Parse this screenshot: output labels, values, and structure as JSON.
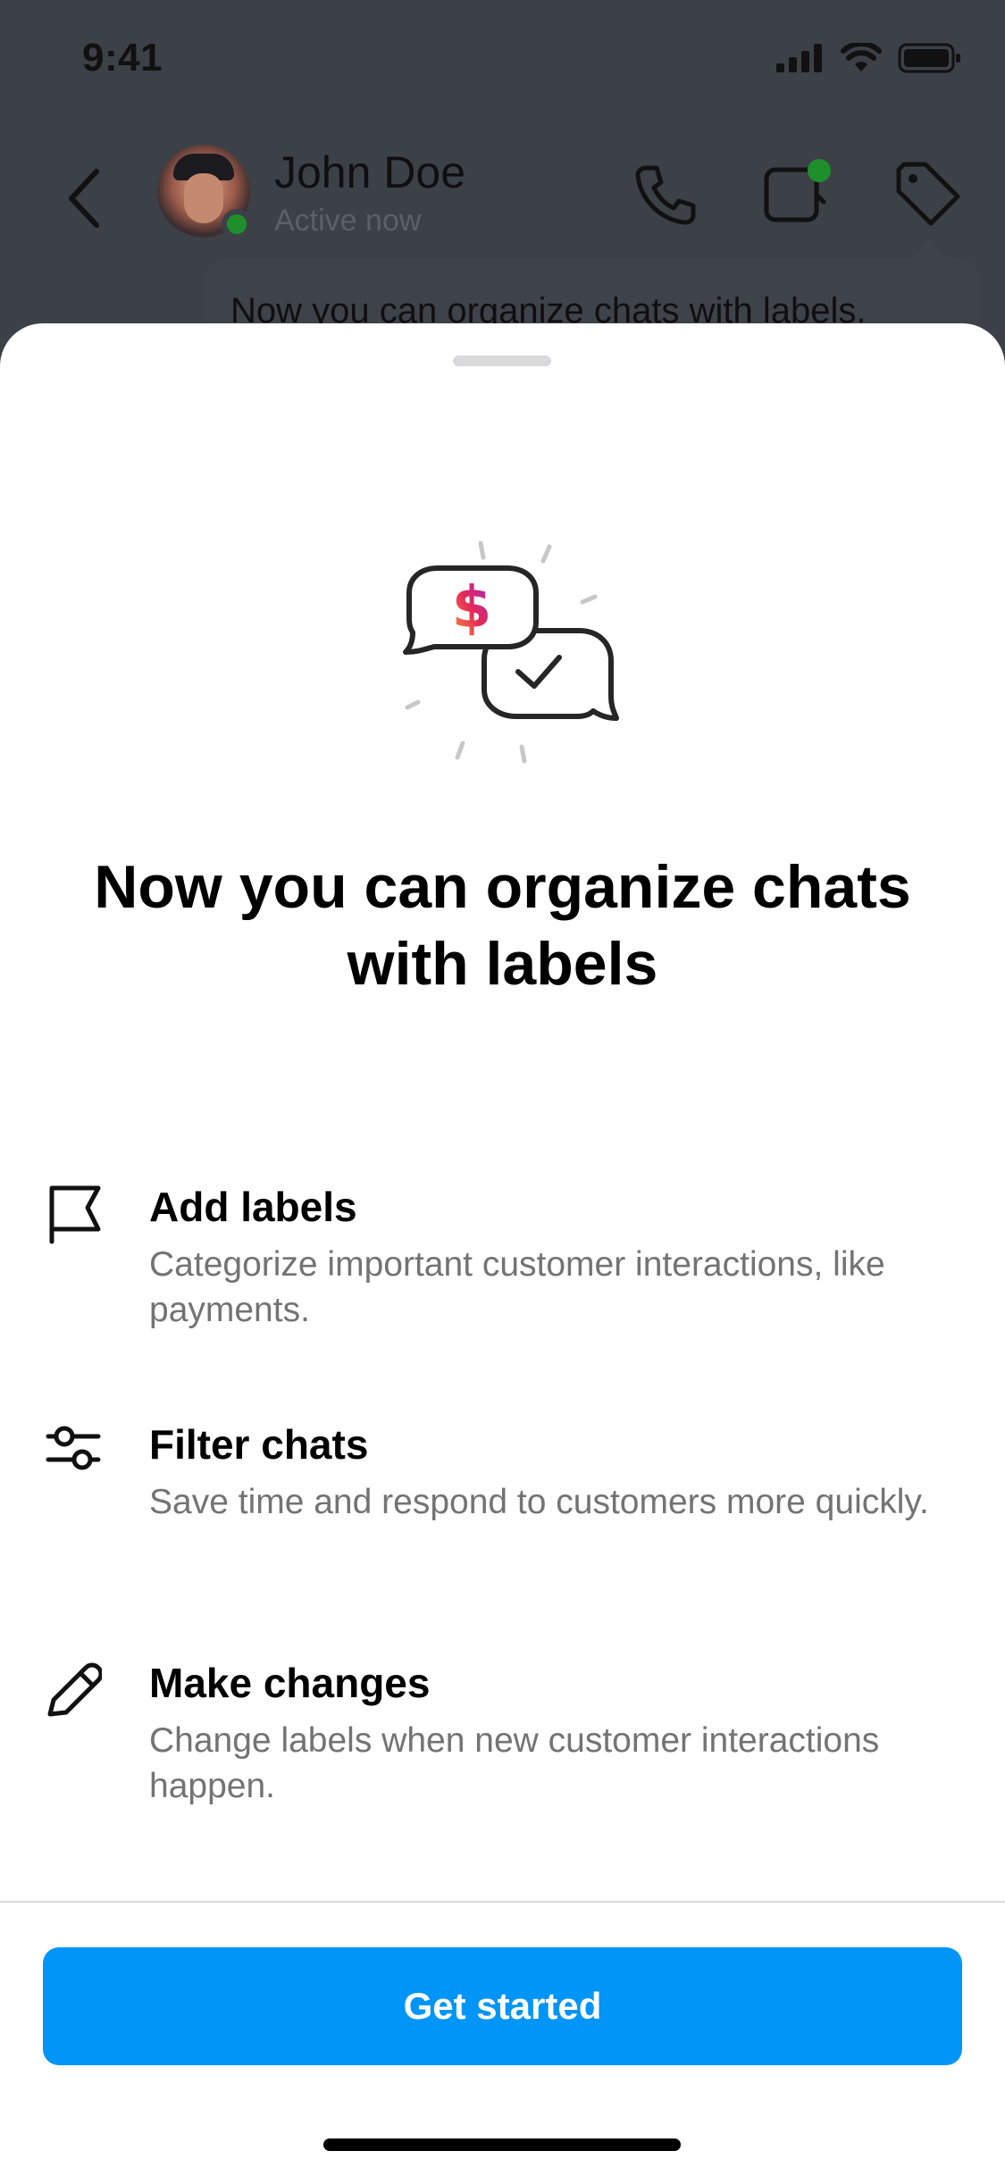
{
  "status_bar": {
    "time": "9:41",
    "icons": [
      "cellular-signal-icon",
      "wifi-icon",
      "battery-icon"
    ]
  },
  "chat_header": {
    "contact_name": "John Doe",
    "contact_status": "Active now",
    "icons": [
      "back-chevron-icon",
      "phone-icon",
      "video-call-icon",
      "tag-icon"
    ]
  },
  "tooltip": {
    "text": "Now you can organize chats with labels."
  },
  "sheet": {
    "title": "Now you can organize chats with labels",
    "illustration": "chat-bubbles-dollar-check-illustration",
    "features": [
      {
        "icon": "flag-icon",
        "title": "Add labels",
        "description": "Categorize important customer interactions, like payments."
      },
      {
        "icon": "sliders-icon",
        "title": "Filter chats",
        "description": "Save time and respond to customers more quickly."
      },
      {
        "icon": "pencil-icon",
        "title": "Make changes",
        "description": "Change labels when new customer interactions happen."
      }
    ],
    "cta_label": "Get started"
  },
  "colors": {
    "accent": "#0095f6",
    "online": "#1f8f2b",
    "overlay": "#3c4047",
    "text_secondary": "#737373"
  }
}
